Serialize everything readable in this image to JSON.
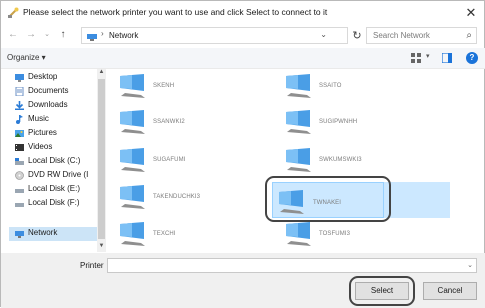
{
  "window": {
    "title": "Please select the network printer you want to use and click Select to connect to it"
  },
  "nav": {
    "path": "Network",
    "search_placeholder": "Search Network"
  },
  "toolbar": {
    "organize_label": "Organize ▾"
  },
  "sidebar": {
    "items": [
      {
        "label": "Desktop",
        "icon": "desktop-icon"
      },
      {
        "label": "Documents",
        "icon": "documents-icon"
      },
      {
        "label": "Downloads",
        "icon": "downloads-icon"
      },
      {
        "label": "Music",
        "icon": "music-icon"
      },
      {
        "label": "Pictures",
        "icon": "pictures-icon"
      },
      {
        "label": "Videos",
        "icon": "videos-icon"
      },
      {
        "label": "Local Disk (C:)",
        "icon": "disk-icon"
      },
      {
        "label": "DVD RW Drive (I",
        "icon": "dvd-icon"
      },
      {
        "label": "Local Disk (E:)",
        "icon": "disk-icon"
      },
      {
        "label": "Local Disk (F:)",
        "icon": "disk-icon"
      },
      {
        "label": "Network",
        "icon": "network-icon",
        "selected": true
      }
    ]
  },
  "computers": [
    {
      "name": "SKENH"
    },
    {
      "name": "SSAITO"
    },
    {
      "name": "SSANWKI2"
    },
    {
      "name": "SUGIPWNHH"
    },
    {
      "name": "SUGAFUMI"
    },
    {
      "name": "SWKUMSWKI3"
    },
    {
      "name": "TAKENDUCHKI3"
    },
    {
      "name": "TWNAKEI",
      "selected": true
    },
    {
      "name": "TEXCHI"
    },
    {
      "name": "TOSFUMI3"
    }
  ],
  "bottom": {
    "printer_label": "Printer",
    "printer_value": "",
    "select_label": "Select",
    "cancel_label": "Cancel"
  },
  "colors": {
    "selection": "#cce8ff",
    "accent": "#1a73d9",
    "ring": "#444444"
  }
}
